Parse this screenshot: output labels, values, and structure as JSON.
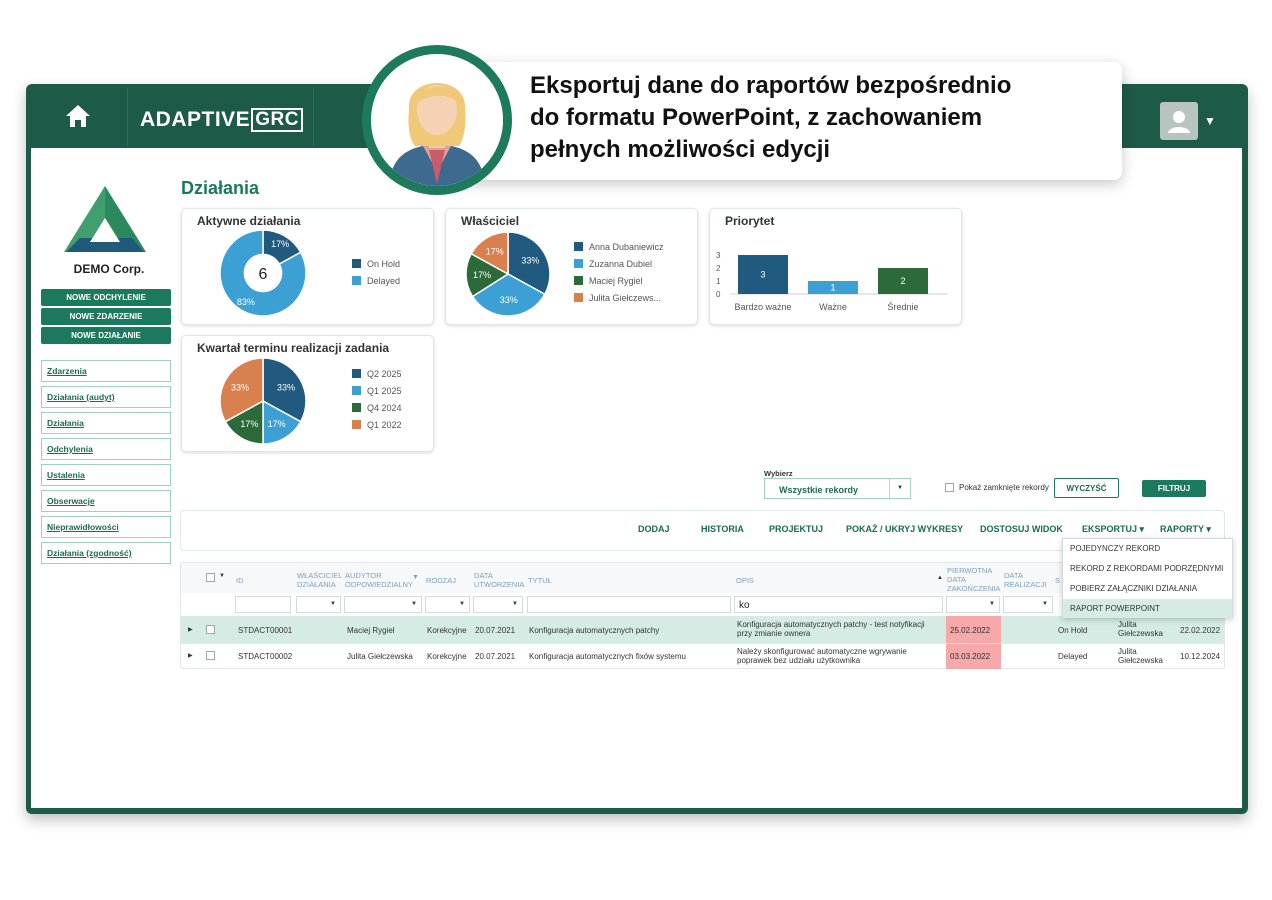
{
  "callout": {
    "line1": "Eksportuj dane do raportów bezpośrednio",
    "line2": "do formatu PowerPoint, z zachowaniem",
    "line3": "pełnych możliwości edycji"
  },
  "header": {
    "logo_main": "ADAPTIVE",
    "logo_boxed": "GRC"
  },
  "sidebar": {
    "company": "DEMO Corp.",
    "buttons": [
      "NOWE ODCHYLENIE",
      "NOWE ZDARZENIE",
      "NOWE DZIAŁANIE"
    ],
    "items": [
      "Zdarzenia",
      "Działania (audyt)",
      "Działania",
      "Odchylenia",
      "Ustalenia",
      "Obserwacje",
      "Nieprawidłowości",
      "Działania (zgodność)"
    ]
  },
  "page": {
    "title": "Działania"
  },
  "charts": {
    "active": {
      "title": "Aktywne działania",
      "center": "6",
      "slices": [
        {
          "label": "On Hold",
          "value": 17,
          "text": "17%",
          "color": "#215a7f"
        },
        {
          "label": "Delayed",
          "value": 83,
          "text": "83%",
          "color": "#3da0d4"
        }
      ]
    },
    "owner": {
      "title": "Właściciel",
      "slices": [
        {
          "label": "Anna Dubaniewicz",
          "value": 33,
          "text": "33%",
          "color": "#215a7f"
        },
        {
          "label": "Zuzanna Dubiel",
          "value": 33,
          "text": "33%",
          "color": "#3da0d4"
        },
        {
          "label": "Maciej Rygiel",
          "value": 17,
          "text": "17%",
          "color": "#2c6a3a"
        },
        {
          "label": "Julita Giełczews...",
          "value": 17,
          "text": "17%",
          "color": "#d9804f"
        }
      ]
    },
    "priority": {
      "title": "Priorytet",
      "y_ticks": [
        "3",
        "2",
        "1",
        "0"
      ],
      "bars": [
        {
          "label": "Bardzo ważne",
          "value": 3,
          "color": "#215a7f"
        },
        {
          "label": "Ważne",
          "value": 1,
          "color": "#3da0d4"
        },
        {
          "label": "Średnie",
          "value": 2,
          "color": "#2c6a3a"
        }
      ]
    },
    "quarter": {
      "title": "Kwartał terminu realizacji zadania",
      "slices": [
        {
          "label": "Q2 2025",
          "value": 33,
          "text": "33%",
          "color": "#215a7f"
        },
        {
          "label": "Q1 2025",
          "value": 17,
          "text": "17%",
          "color": "#3da0d4"
        },
        {
          "label": "Q4 2024",
          "value": 17,
          "text": "17%",
          "color": "#2c6a3a"
        },
        {
          "label": "Q1 2022",
          "value": 33,
          "text": "33%",
          "color": "#d9804f"
        }
      ]
    }
  },
  "filters": {
    "select_label": "Wybierz",
    "select_value": "Wszystkie rekordy",
    "show_closed": "Pokaż zamknięte rekordy",
    "clear": "WYCZYŚĆ",
    "filter": "FILTRUJ"
  },
  "toolbar": [
    "DODAJ",
    "HISTORIA",
    "PROJEKTUJ",
    "POKAŻ / UKRYJ WYKRESY",
    "DOSTOSUJ WIDOK",
    "EKSPORTUJ ▾",
    "RAPORTY ▾"
  ],
  "export_menu": [
    "POJEDYNCZY REKORD",
    "REKORD Z REKORDAMI PODRZĘDNYMI",
    "POBIERZ ZAŁĄCZNIKI DZIAŁANIA",
    "RAPORT POWERPOINT"
  ],
  "grid": {
    "headers": {
      "id": "ID",
      "owner1": "WŁAŚCICIEL",
      "owner2": "DZIAŁANIA",
      "auditor1": "AUDYTOR",
      "auditor2": "ODPOWIEDZIALNY",
      "type": "RODZAJ",
      "created1": "DATA",
      "created2": "UTWORZENIA",
      "title": "TYTUŁ",
      "desc": "OPIS",
      "due1": "PIERWOTNA",
      "due2": "DATA",
      "due3": "ZAKOŃCZENIA",
      "done1": "DATA",
      "done2": "REALIZACJI",
      "status": "S"
    },
    "filter_desc": "ko",
    "rows": [
      {
        "id": "STDACT00001",
        "auditor": "Maciej Rygiel",
        "type": "Korekcyjne",
        "created": "20.07.2021",
        "title": "Konfiguracja automatycznych patchy",
        "desc1": "Konfiguracja automatycznych patchy - test notyfikacji",
        "desc2": "przy zmianie ownera",
        "due": "25.02.2022",
        "status": "On Hold",
        "person1": "Julita",
        "person2": "Giełczewska",
        "date": "22.02.2022"
      },
      {
        "id": "STDACT00002",
        "auditor": "Julita Giełczewska",
        "type": "Korekcyjne",
        "created": "20.07.2021",
        "title": "Konfiguracja automatycznych fixów systemu",
        "desc1": "Należy skonfigurować automatyczne wgrywanie",
        "desc2": "poprawek bez udziału użytkownika",
        "due": "03.03.2022",
        "status": "Delayed",
        "person1": "Julita",
        "person2": "Giełczewska",
        "date": "10.12.2024"
      }
    ]
  }
}
